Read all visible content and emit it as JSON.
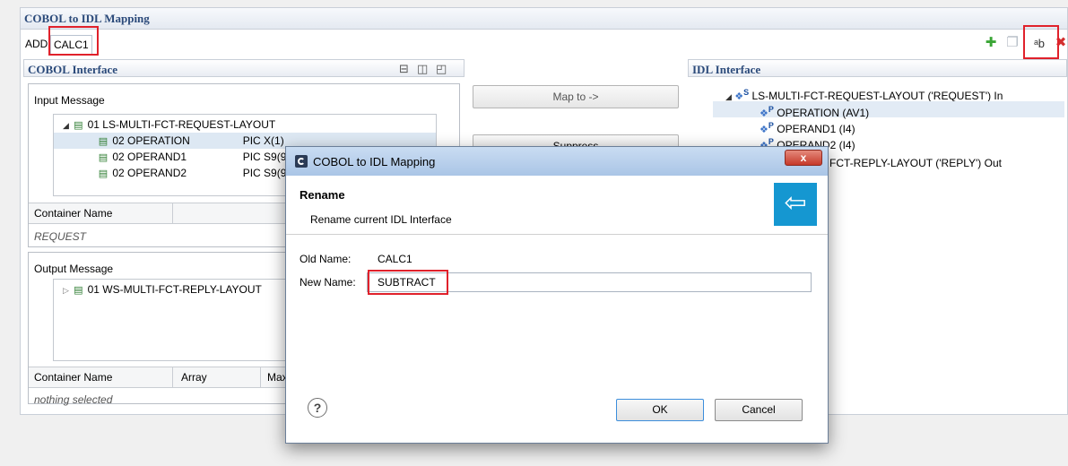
{
  "window": {
    "title": "COBOL to IDL Mapping"
  },
  "tabs": {
    "add_label": "ADD",
    "current_label": "CALC1"
  },
  "toolbar": {
    "add_icon": "plus-icon",
    "copy_icon": "copy-icon",
    "rename_icon": "rename-icon",
    "delete_icon": "delete-icon"
  },
  "cobol": {
    "title": "COBOL Interface",
    "input": {
      "title": "Input Message",
      "root": "01 LS-MULTI-FCT-REQUEST-LAYOUT",
      "fields": [
        {
          "name": "02 OPERATION",
          "pic": "PIC X(1)"
        },
        {
          "name": "02 OPERAND1",
          "pic": "PIC S9(9)"
        },
        {
          "name": "02 OPERAND2",
          "pic": "PIC S9(9)"
        }
      ],
      "table_header": "Container Name",
      "table_value": "REQUEST"
    },
    "output": {
      "title": "Output Message",
      "root": "01 WS-MULTI-FCT-REPLY-LAYOUT",
      "table_headers": [
        "Container Name",
        "Array",
        "Max"
      ],
      "table_value": "nothing selected"
    }
  },
  "middle": {
    "map_to": "Map to ->",
    "suppress": "Suppress"
  },
  "idl": {
    "title": "IDL Interface",
    "root": "LS-MULTI-FCT-REQUEST-LAYOUT  ('REQUEST')  In",
    "params": [
      "OPERATION  (AV1)",
      "OPERAND1  (I4)",
      "OPERAND2  (I4)"
    ],
    "reply": "FCT-REPLY-LAYOUT  ('REPLY')  Out"
  },
  "dialog": {
    "title": "COBOL to IDL Mapping",
    "close": "x",
    "heading": "Rename",
    "subheading": "Rename current IDL Interface",
    "old_name_label": "Old Name:",
    "old_name_value": "CALC1",
    "new_name_label": "New Name:",
    "new_name_value": "SUBTRACT",
    "help": "?",
    "ok": "OK",
    "cancel": "Cancel"
  }
}
